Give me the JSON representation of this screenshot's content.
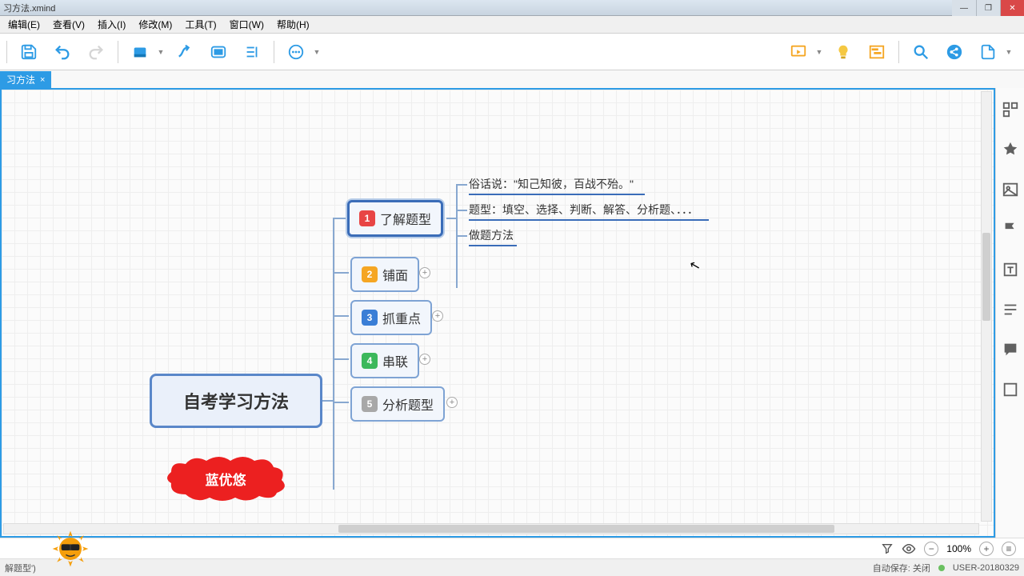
{
  "window": {
    "title": "习方法.xmind"
  },
  "menu": {
    "edit": "编辑(E)",
    "view": "查看(V)",
    "insert": "插入(I)",
    "modify": "修改(M)",
    "tools": "工具(T)",
    "window": "窗口(W)",
    "help": "帮助(H)"
  },
  "tab": {
    "label": "习方法",
    "close": "×"
  },
  "mindmap": {
    "root": "自考学习方法",
    "nodes": [
      {
        "num": "1",
        "label": "了解题型",
        "selected": true
      },
      {
        "num": "2",
        "label": "铺面"
      },
      {
        "num": "3",
        "label": "抓重点"
      },
      {
        "num": "4",
        "label": "串联"
      },
      {
        "num": "5",
        "label": "分析题型"
      }
    ],
    "leaves": [
      "俗话说：\"知己知彼，百战不殆。\"",
      "题型：填空、选择、判断、解答、分析题、．．．",
      "做题方法"
    ],
    "cloud": "蓝优悠"
  },
  "status": {
    "zoom": "100%",
    "bottom_left": "解题型')",
    "autosave": "自动保存: 关闭",
    "user": "USER-20180329"
  }
}
